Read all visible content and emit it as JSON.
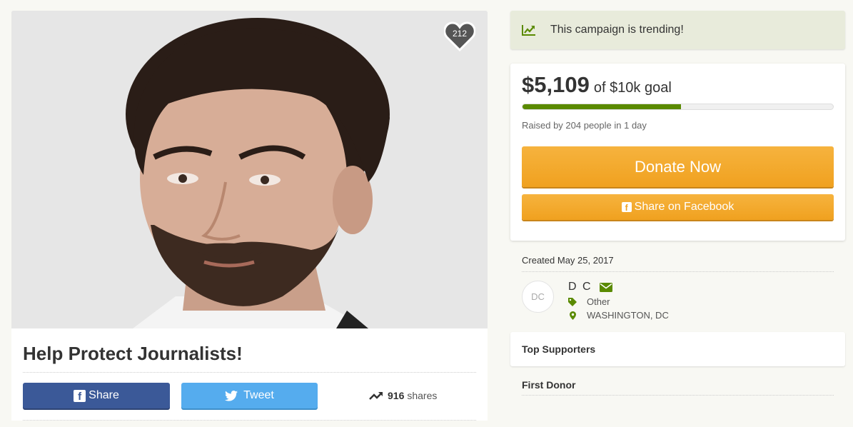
{
  "campaign": {
    "title": "Help Protect Journalists!",
    "hearts": "212"
  },
  "social": {
    "share_label": "Share",
    "tweet_label": "Tweet",
    "shares_count": "916",
    "shares_label": "shares"
  },
  "sidebar": {
    "trending_text": "This campaign is trending!",
    "amount": "$5,109",
    "goal_text": "of $10k goal",
    "progress_fraction": 0.51,
    "raised_text": "Raised by 204 people in 1 day",
    "donate_label": "Donate Now",
    "fb_share_label": "Share on Facebook",
    "created_text": "Created May 25, 2017",
    "organizer_initials": "DC",
    "organizer_name": "D C",
    "category": "Other",
    "location": "WASHINGTON, DC",
    "top_supporters_label": "Top Supporters",
    "first_donor_label": "First Donor"
  },
  "colors": {
    "accent_green": "#5a8a00",
    "donate_orange": "#f0a11f",
    "facebook_blue": "#3b5998",
    "twitter_blue": "#55acee"
  },
  "icons": {
    "heart": "heart-icon",
    "trend": "trend-chart-icon",
    "facebook": "facebook-icon",
    "twitter": "twitter-icon",
    "shares": "trending-arrow-icon",
    "email": "envelope-icon",
    "tag": "tag-icon",
    "location": "map-pin-icon"
  }
}
